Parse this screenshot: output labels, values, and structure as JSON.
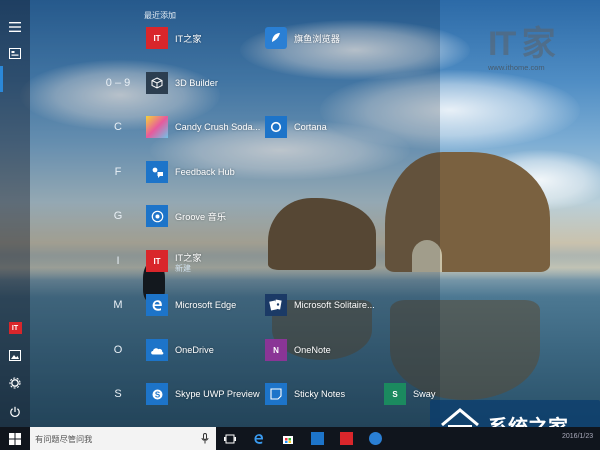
{
  "start_menu": {
    "recently_added_header": "最近添加",
    "letters": [
      "0 – 9",
      "C",
      "F",
      "G",
      "I",
      "M",
      "O",
      "S"
    ],
    "apps": {
      "itzhijia_recent": "IT之家",
      "browser_recent": "旗鱼浏览器",
      "builder3d": "3D Builder",
      "candy": "Candy Crush Soda...",
      "cortana": "Cortana",
      "feedback": "Feedback Hub",
      "groove": "Groove 音乐",
      "itzhijia": "IT之家",
      "itzhijia_sub": "新建",
      "edge": "Microsoft Edge",
      "solitaire": "Microsoft Solitaire...",
      "onedrive": "OneDrive",
      "onenote": "OneNote",
      "skype": "Skype UWP Preview",
      "sticky": "Sticky Notes",
      "sway": "Sway"
    },
    "tile_glyphs": {
      "it": "IT",
      "onenote": "N",
      "sway": "S"
    }
  },
  "rail": {
    "icons": [
      "hamburger-icon",
      "all-apps-icon",
      "ithome-icon",
      "pictures-icon",
      "settings-icon",
      "power-icon"
    ],
    "ithome_glyph": "IT"
  },
  "taskbar": {
    "search_placeholder": "有问题尽管问我",
    "clock_text": "2016/1/23"
  },
  "watermarks": {
    "top_logo": "IT 家",
    "top_url": "www.ithome.com",
    "bottom_text": "系统之家"
  },
  "colors": {
    "accent": "#2b88d8",
    "it_red": "#d9262b",
    "edge_blue": "#1d74c9",
    "onenote_purple": "#8a3596",
    "sway_green": "#1b8a5f",
    "taskbar": "#10151d"
  }
}
